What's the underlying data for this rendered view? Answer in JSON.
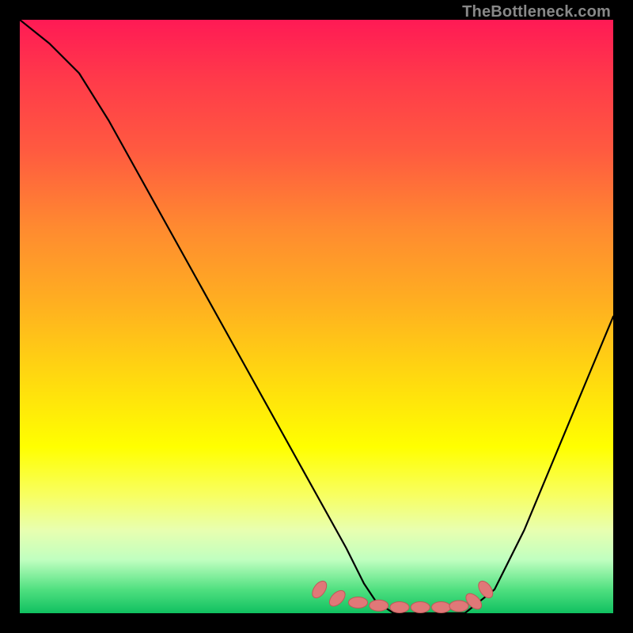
{
  "watermark": "TheBottleneck.com",
  "palette": {
    "background": "#000000",
    "line": "#000000",
    "marker_fill": "#e07878",
    "marker_stroke": "#c05858"
  },
  "chart_data": {
    "type": "line",
    "title": "",
    "xlabel": "",
    "ylabel": "",
    "xlim": [
      0,
      100
    ],
    "ylim": [
      0,
      100
    ],
    "x": [
      0,
      5,
      10,
      15,
      20,
      25,
      30,
      35,
      40,
      45,
      50,
      55,
      58,
      60,
      63,
      66,
      70,
      75,
      80,
      85,
      90,
      95,
      100
    ],
    "y": [
      100,
      96,
      91,
      83,
      74,
      65,
      56,
      47,
      38,
      29,
      20,
      11,
      5,
      2,
      0,
      0,
      0,
      0,
      4,
      14,
      26,
      38,
      50
    ],
    "annotations": [],
    "markers": {
      "x": [
        50.5,
        53.5,
        57.0,
        60.5,
        64.0,
        67.5,
        71.0,
        74.0,
        76.5,
        78.5
      ],
      "y": [
        4.0,
        2.5,
        1.8,
        1.3,
        1.0,
        1.0,
        1.0,
        1.2,
        2.0,
        4.0
      ]
    }
  }
}
